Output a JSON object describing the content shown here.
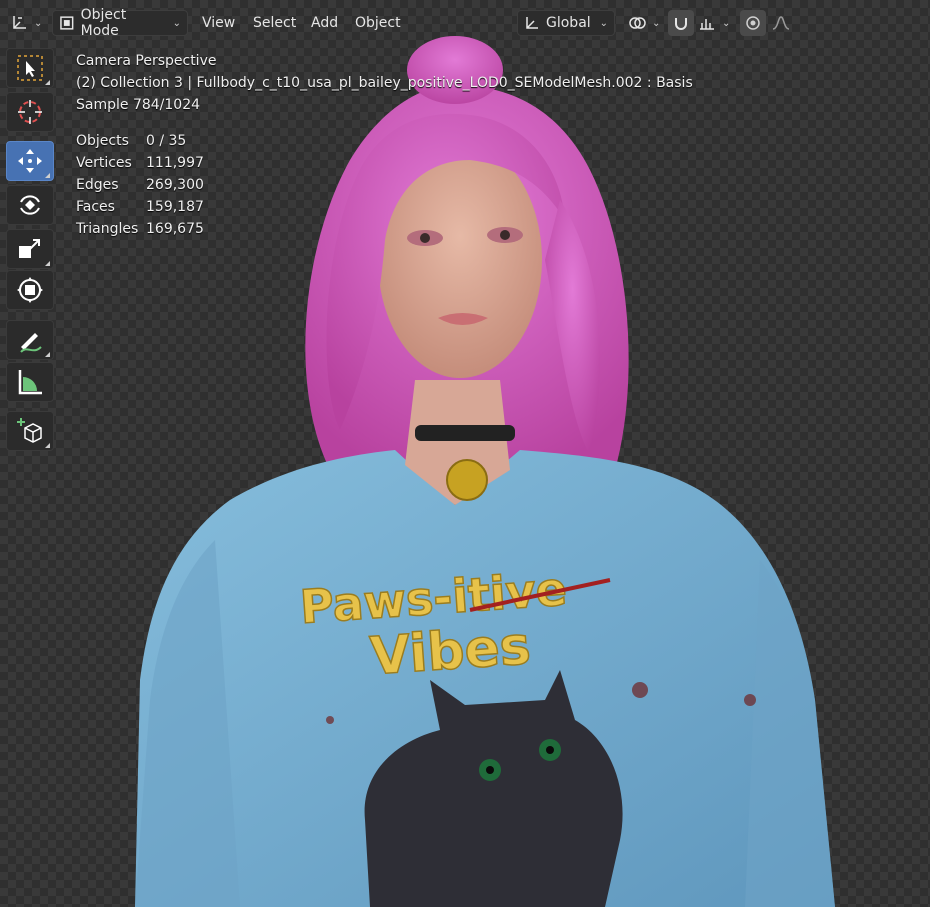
{
  "header": {
    "mode_label": "Object Mode",
    "menus": [
      "View",
      "Select",
      "Add",
      "Object"
    ],
    "transform_orientation": "Global"
  },
  "overlay": {
    "view_name": "Camera Perspective",
    "object_info": "(2) Collection 3 | Fullbody_c_t10_usa_pl_bailey_positive_LOD0_SEModelMesh.002 : Basis",
    "sample": "Sample 784/1024"
  },
  "stats": [
    {
      "label": "Objects",
      "value": "0 / 35"
    },
    {
      "label": "Vertices",
      "value": "111,997"
    },
    {
      "label": "Edges",
      "value": "269,300"
    },
    {
      "label": "Faces",
      "value": "159,187"
    },
    {
      "label": "Triangles",
      "value": "169,675"
    }
  ],
  "toolbar": [
    {
      "name": "select-box-tool",
      "icon": "select-box-icon"
    },
    {
      "name": "cursor-tool",
      "icon": "cursor-icon"
    },
    {
      "name": "move-tool",
      "icon": "move-icon",
      "active": true
    },
    {
      "name": "rotate-tool",
      "icon": "rotate-icon"
    },
    {
      "name": "scale-tool",
      "icon": "scale-icon"
    },
    {
      "name": "transform-tool",
      "icon": "transform-icon"
    },
    {
      "name": "annotate-tool",
      "icon": "annotate-icon"
    },
    {
      "name": "measure-tool",
      "icon": "measure-icon"
    },
    {
      "name": "add-cube-tool",
      "icon": "add-cube-icon"
    }
  ],
  "render": {
    "shirt_text_line1": "Paws-itive",
    "shirt_text_line2": "Vibes"
  },
  "colors": {
    "accent_active": "#4772b3",
    "hair": "#d65fc8",
    "sweater": "#7fb3d3",
    "embroidery": "#e7c24a"
  }
}
